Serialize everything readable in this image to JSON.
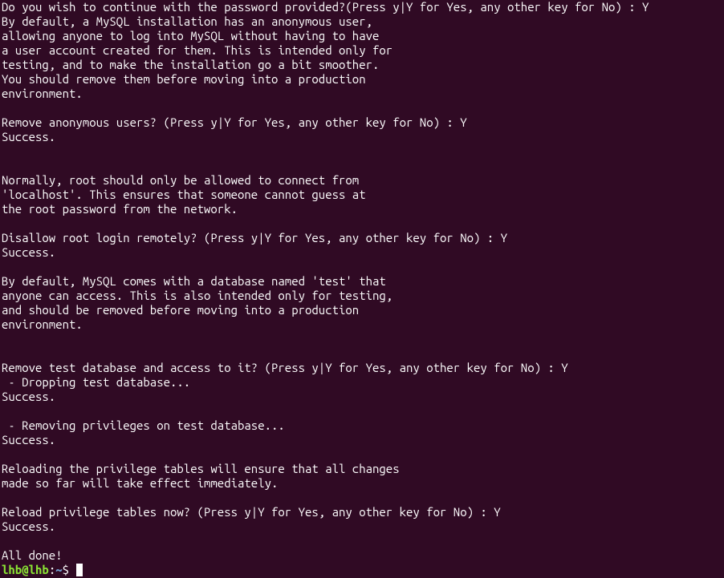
{
  "terminal": {
    "output": "Do you wish to continue with the password provided?(Press y|Y for Yes, any other key for No) : Y\nBy default, a MySQL installation has an anonymous user,\nallowing anyone to log into MySQL without having to have\na user account created for them. This is intended only for\ntesting, and to make the installation go a bit smoother.\nYou should remove them before moving into a production\nenvironment.\n\nRemove anonymous users? (Press y|Y for Yes, any other key for No) : Y\nSuccess.\n\n\nNormally, root should only be allowed to connect from\n'localhost'. This ensures that someone cannot guess at\nthe root password from the network.\n\nDisallow root login remotely? (Press y|Y for Yes, any other key for No) : Y\nSuccess.\n\nBy default, MySQL comes with a database named 'test' that\nanyone can access. This is also intended only for testing,\nand should be removed before moving into a production\nenvironment.\n\n\nRemove test database and access to it? (Press y|Y for Yes, any other key for No) : Y\n - Dropping test database...\nSuccess.\n\n - Removing privileges on test database...\nSuccess.\n\nReloading the privilege tables will ensure that all changes\nmade so far will take effect immediately.\n\nReload privilege tables now? (Press y|Y for Yes, any other key for No) : Y\nSuccess.\n\nAll done!"
  },
  "prompt": {
    "user": "lhb",
    "at": "@",
    "host": "lhb",
    "colon": ":",
    "path": "~",
    "dollar": "$"
  }
}
